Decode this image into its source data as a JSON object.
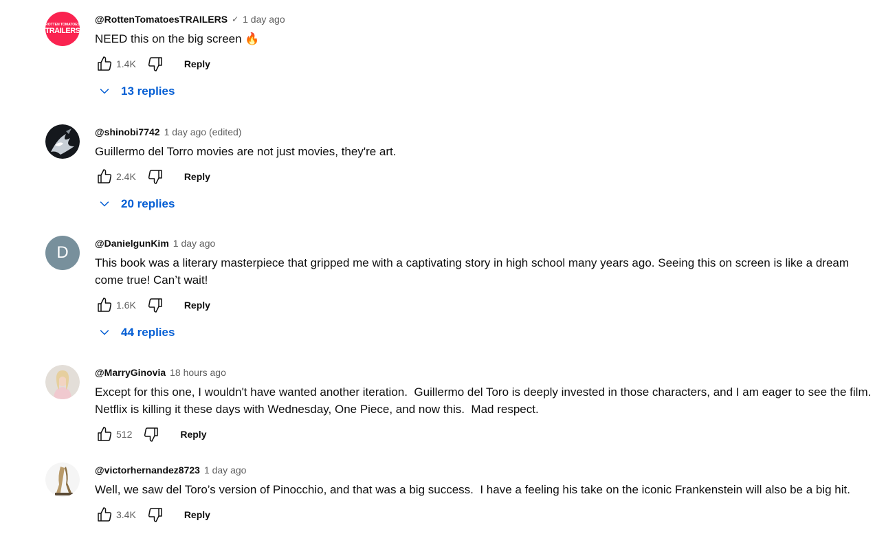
{
  "comments": [
    {
      "author": "@RottenTomatoesTRAILERS",
      "verified": "✓",
      "time": "1 day ago",
      "text": "NEED this on the big screen 🔥",
      "likes": "1.4K",
      "reply_label": "Reply",
      "replies_label": "13 replies",
      "avatar": {
        "small": "ROTTEN TOMATOES",
        "big": "TRAILERS",
        "color": "#fa2350"
      }
    },
    {
      "author": "@shinobi7742",
      "time": "1 day ago (edited)",
      "text": "Guillermo del Torro movies are not just movies, they're art.",
      "likes": "2.4K",
      "reply_label": "Reply",
      "replies_label": "20 replies"
    },
    {
      "author": "@DanielgunKim",
      "time": "1 day ago",
      "text": "This book was a literary masterpiece that gripped me with a captivating story in high school many years ago. Seeing this on screen is like a dream come true! Can’t wait!",
      "likes": "1.6K",
      "reply_label": "Reply",
      "replies_label": "44 replies",
      "avatar": {
        "letter": "D",
        "color": "#78909c"
      }
    },
    {
      "author": "@MarryGinovia",
      "time": "18 hours ago",
      "text": "Except for this one, I wouldn't have wanted another iteration.  Guillermo del Toro is deeply invested in those characters, and I am eager to see the film.  Netflix is killing it these days with Wednesday, One Piece, and now this.  Mad respect.",
      "likes": "512",
      "reply_label": "Reply"
    },
    {
      "author": "@victorhernandez8723",
      "time": "1 day ago",
      "text": "Well, we saw del Toro’s version of Pinocchio, and that was a big success.  I have a feeling his take on the iconic Frankenstein will also be a big hit.",
      "likes": "3.4K",
      "reply_label": "Reply"
    }
  ],
  "colors": {
    "link_blue": "#065fd4",
    "meta_gray": "#606060",
    "text": "#0f0f0f"
  },
  "icons": [
    "thumbs-up-icon",
    "thumbs-down-icon",
    "chevron-down-icon",
    "verified-check-icon"
  ]
}
